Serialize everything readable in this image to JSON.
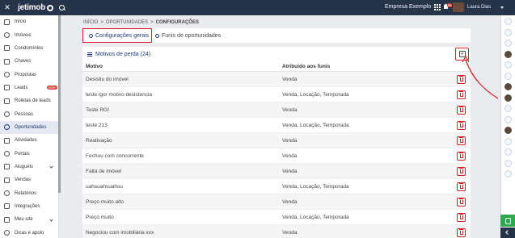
{
  "header": {
    "close_icon": "close-icon",
    "logo": "jetimob",
    "company": "Empresa Exemplo",
    "notification_count": "99",
    "user_name": "Laura Dias"
  },
  "sidebar": {
    "items": [
      {
        "label": "Início",
        "icon": "home-icon"
      },
      {
        "label": "Imóveis",
        "icon": "building-icon"
      },
      {
        "label": "Condomínios",
        "icon": "condo-icon"
      },
      {
        "label": "Chaves",
        "icon": "key-icon"
      },
      {
        "label": "Propostas",
        "icon": "proposal-icon"
      },
      {
        "label": "Leads",
        "icon": "leads-icon",
        "badge": "999+"
      },
      {
        "label": "Roletas de leads",
        "icon": "roulette-icon"
      },
      {
        "label": "Pessoas",
        "icon": "people-icon"
      },
      {
        "label": "Oportunidades",
        "icon": "opportunity-icon",
        "active": true
      },
      {
        "label": "Atividades",
        "icon": "check-icon"
      },
      {
        "label": "Portais",
        "icon": "megaphone-icon"
      },
      {
        "label": "Aluguéis",
        "icon": "rent-icon",
        "expandable": true
      },
      {
        "label": "Vendas",
        "icon": "sales-icon"
      },
      {
        "label": "Relatórios",
        "icon": "report-icon"
      },
      {
        "label": "Integrações",
        "icon": "integration-icon"
      },
      {
        "label": "Meu site",
        "icon": "globe-icon",
        "expandable": true
      },
      {
        "label": "Dicas e apoio",
        "icon": "help-icon"
      }
    ]
  },
  "breadcrumb": {
    "items": [
      "INÍCIO",
      "OPORTUNIDADES",
      "CONFIGURAÇÕES"
    ],
    "separator": ">"
  },
  "tabs": [
    {
      "label": "Configurações gerais",
      "active": true
    },
    {
      "label": "Funis de oportunidades",
      "active": false
    }
  ],
  "panel": {
    "title": "Motivos de perda (24)",
    "add_button": "+",
    "columns": [
      "Motivo",
      "Atribuído aos funis"
    ],
    "rows": [
      {
        "motivo": "Desistiu do imovel",
        "funis": "Venda"
      },
      {
        "motivo": "teste igor motivo desistencia",
        "funis": "Venda, Locação, Temporada"
      },
      {
        "motivo": "Teste RGI",
        "funis": "Venda"
      },
      {
        "motivo": "teste 213",
        "funis": "Venda, Locação, Temporada"
      },
      {
        "motivo": "Reativação",
        "funis": "Venda"
      },
      {
        "motivo": "Fechou com concorrente",
        "funis": "Venda"
      },
      {
        "motivo": "Falta de imóvel",
        "funis": "Venda"
      },
      {
        "motivo": "uahsuahsuahsu",
        "funis": "Venda, Locação, Temporada"
      },
      {
        "motivo": "Preço muito alto",
        "funis": "Venda"
      },
      {
        "motivo": "Preço muito",
        "funis": "Venda, Locação, Temporada"
      },
      {
        "motivo": "Negociou com imobiliária xxx",
        "funis": "Venda"
      }
    ]
  },
  "colors": {
    "topbar": "#26344a",
    "highlight": "#d91f26",
    "active_nav": "#1b3b7a"
  }
}
